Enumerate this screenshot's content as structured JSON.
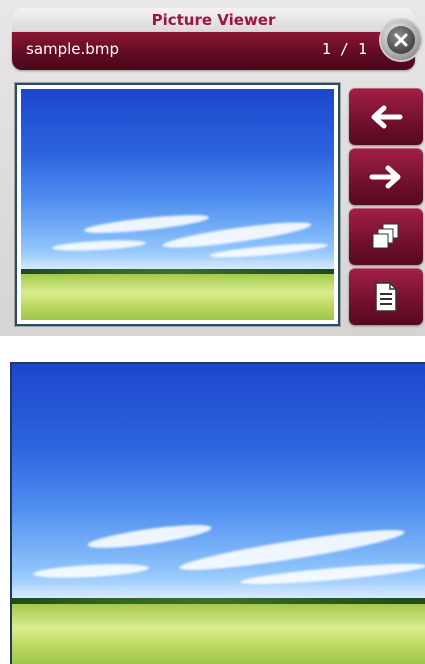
{
  "app": {
    "title": "Picture Viewer",
    "filename": "sample.bmp",
    "counter": "1 / 1"
  },
  "toolbar": {
    "buttons": [
      {
        "icon": "arrow-left-icon",
        "action": "previous"
      },
      {
        "icon": "arrow-right-icon",
        "action": "next"
      },
      {
        "icon": "copy-icon",
        "action": "copy"
      },
      {
        "icon": "document-icon",
        "action": "details"
      }
    ]
  },
  "colors": {
    "accent": "#8a1634",
    "accent_dark": "#4a0819",
    "title_text": "#9a1543",
    "panel_bg": "#dcd9d9",
    "frame_border": "#2d4c62"
  },
  "image": {
    "subject": "sky-and-grass-field"
  }
}
